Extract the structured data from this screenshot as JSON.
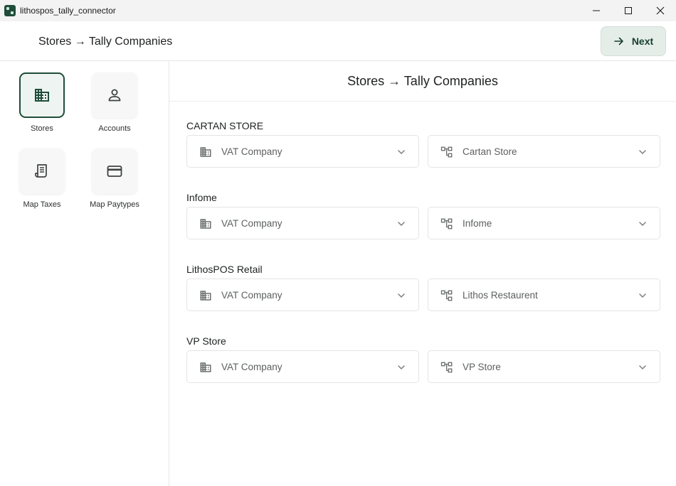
{
  "window": {
    "title": "lithospos_tally_connector",
    "icons": {
      "app": "app-icon",
      "minimize": "minimize-icon",
      "maximize": "maximize-icon",
      "close": "close-icon"
    }
  },
  "header": {
    "title": "Stores → Tally Companies",
    "next_label": "Next",
    "next_icon": "arrow-right-icon"
  },
  "sidebar": {
    "items": [
      {
        "label": "Stores",
        "icon": "building-icon",
        "active": true
      },
      {
        "label": "Accounts",
        "icon": "person-icon",
        "active": false
      },
      {
        "label": "Map Taxes",
        "icon": "receipt-icon",
        "active": false
      },
      {
        "label": "Map Paytypes",
        "icon": "credit-card-icon",
        "active": false
      }
    ]
  },
  "main": {
    "title": "Stores → Tally Companies",
    "stores": [
      {
        "name": "CARTAN STORE",
        "company": "VAT Company",
        "branch": "Cartan Store"
      },
      {
        "name": "Infome",
        "company": "VAT Company",
        "branch": "Infome"
      },
      {
        "name": "LithosPOS Retail",
        "company": "VAT Company",
        "branch": "Lithos Restaurent"
      },
      {
        "name": "VP Store",
        "company": "VAT Company",
        "branch": "VP Store"
      }
    ]
  },
  "colors": {
    "accent": "#1f4d3a",
    "next_bg": "#e5ede9",
    "border": "#e2e5e3"
  }
}
